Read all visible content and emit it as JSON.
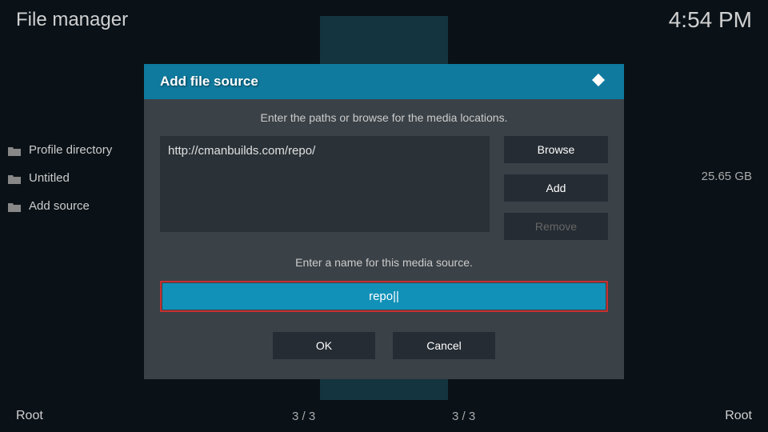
{
  "header": {
    "title": "File manager",
    "time": "4:54 PM"
  },
  "sidebar": {
    "items": [
      {
        "label": "Profile directory"
      },
      {
        "label": "Untitled"
      },
      {
        "label": "Add source"
      }
    ],
    "size": "25.65 GB"
  },
  "modal": {
    "title": "Add file source",
    "path_instruction": "Enter the paths or browse for the media locations.",
    "path_value": "http://cmanbuilds.com/repo/",
    "browse_label": "Browse",
    "add_label": "Add",
    "remove_label": "Remove",
    "name_instruction": "Enter a name for this media source.",
    "name_value": "repo",
    "ok_label": "OK",
    "cancel_label": "Cancel"
  },
  "footer": {
    "left": "Root",
    "center1": "3 / 3",
    "center2": "3 / 3",
    "right": "Root"
  }
}
